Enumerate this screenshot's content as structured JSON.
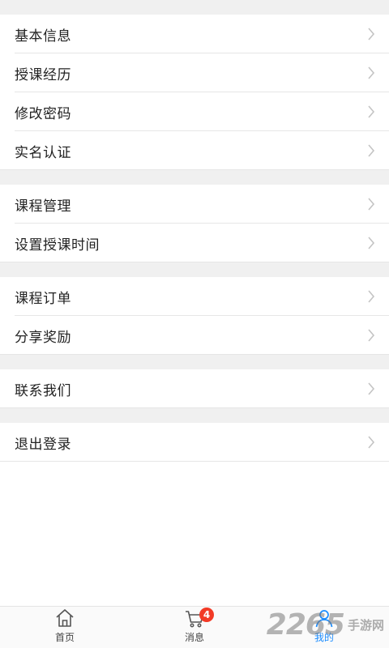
{
  "menu": {
    "group1": [
      {
        "label": "基本信息",
        "name": "menu-item-basic-info"
      },
      {
        "label": "授课经历",
        "name": "menu-item-teaching-experience"
      },
      {
        "label": "修改密码",
        "name": "menu-item-change-password"
      },
      {
        "label": "实名认证",
        "name": "menu-item-real-name-verification"
      }
    ],
    "group2": [
      {
        "label": "课程管理",
        "name": "menu-item-course-management"
      },
      {
        "label": "设置授课时间",
        "name": "menu-item-set-teaching-time"
      }
    ],
    "group3": [
      {
        "label": "课程订单",
        "name": "menu-item-course-orders"
      },
      {
        "label": "分享奖励",
        "name": "menu-item-share-rewards"
      }
    ],
    "group4": [
      {
        "label": "联系我们",
        "name": "menu-item-contact-us"
      }
    ],
    "group5": [
      {
        "label": "退出登录",
        "name": "menu-item-logout"
      }
    ]
  },
  "tabbar": {
    "home_label": "首页",
    "messages_label": "消息",
    "messages_badge": "4",
    "profile_label": "我的",
    "home_icon": "home-icon",
    "messages_icon": "cart-icon",
    "profile_icon": "user-icon",
    "active_color": "#1a8cff"
  },
  "watermark": {
    "number": "2265",
    "text": "手游网"
  }
}
